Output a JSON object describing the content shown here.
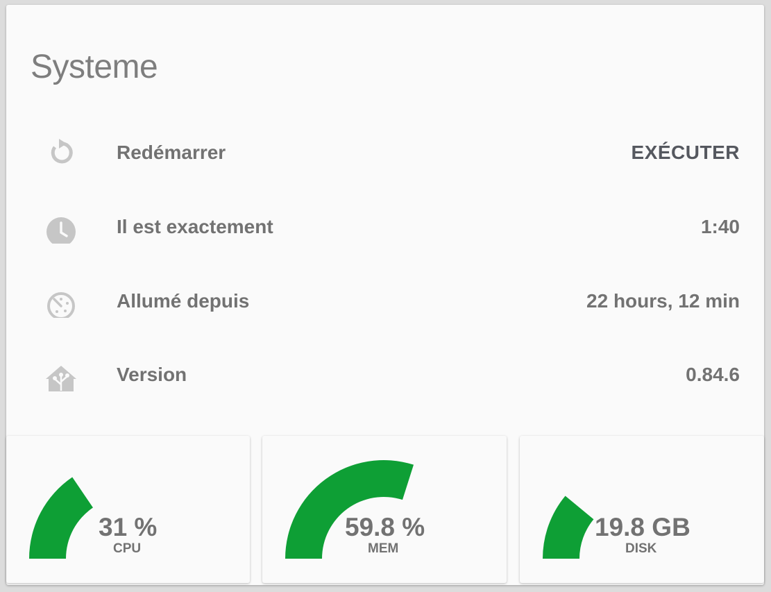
{
  "card": {
    "title": "Systeme",
    "rows": [
      {
        "icon": "restart-icon",
        "label": "Redémarrer",
        "value": "EXÉCUTER",
        "type": "action"
      },
      {
        "icon": "clock-icon",
        "label": "Il est exactement",
        "value": "1:40",
        "type": "value"
      },
      {
        "icon": "timer-icon",
        "label": "Allumé depuis",
        "value": "22 hours, 12 min",
        "type": "value"
      },
      {
        "icon": "home-assistant-icon",
        "label": "Version",
        "value": "0.84.6",
        "type": "value"
      }
    ]
  },
  "gauges": [
    {
      "value": "31 %",
      "name": "CPU",
      "fraction": 0.31
    },
    {
      "value": "59.8 %",
      "name": "MEM",
      "fraction": 0.598
    },
    {
      "value": "19.8 GB",
      "name": "DISK",
      "fraction": 0.22
    }
  ],
  "colors": {
    "gauge_fill": "#0e9f35",
    "icon": "#c6c6c6",
    "text": "#727272",
    "action": "#55585f"
  }
}
